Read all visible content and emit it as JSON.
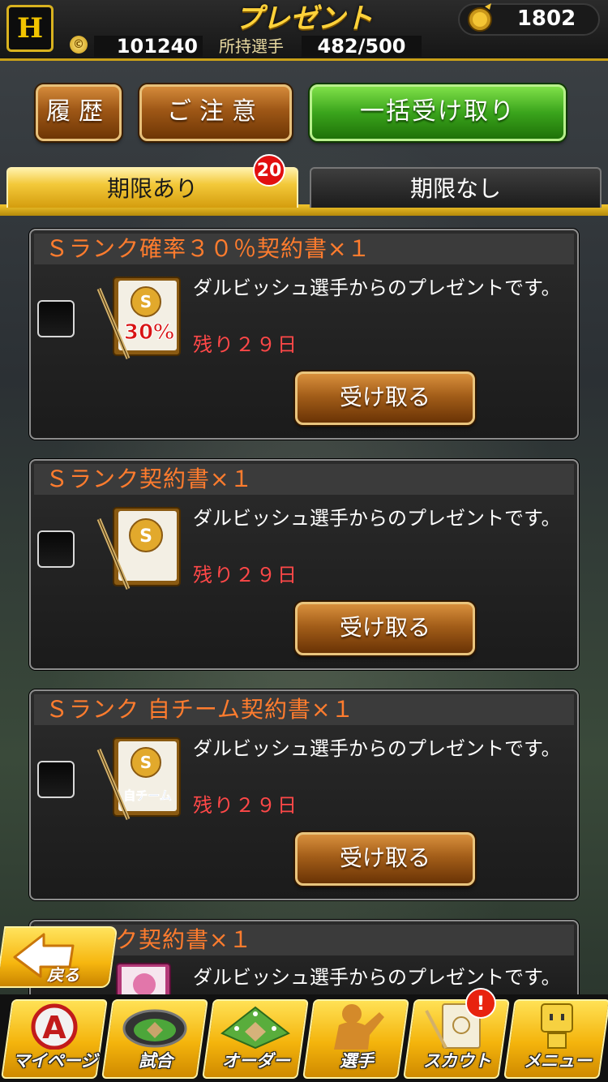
{
  "header": {
    "logo_text": "H",
    "title": "プレゼント",
    "coins": "1802",
    "gold": "101240",
    "players_label": "所持選手",
    "players_count": "482/500"
  },
  "toolbar": {
    "history_label": "履歴",
    "notice_label": "ご注意",
    "receive_all_label": "一括受け取り"
  },
  "tabs": {
    "active_label": "期限あり",
    "inactive_label": "期限なし",
    "badge_count": "20"
  },
  "presents": [
    {
      "title": "Ｓランク確率３０％契約書×１",
      "description": "ダルビッシュ選手からのプレゼントです。",
      "remaining": "残り２９日",
      "button": "受け取る",
      "icon_text": "30%"
    },
    {
      "title": "Ｓランク契約書×１",
      "description": "ダルビッシュ選手からのプレゼントです。",
      "remaining": "残り２９日",
      "button": "受け取る",
      "icon_text": ""
    },
    {
      "title": "Ｓランク 自チーム契約書×１",
      "description": "ダルビッシュ選手からのプレゼントです。",
      "remaining": "残り２９日",
      "button": "受け取る",
      "icon_text": "自チーム"
    },
    {
      "title": "ク契約書×１",
      "description": "ダルビッシュ選手からのプレゼントです。"
    }
  ],
  "back_label": "戻る",
  "nav": [
    {
      "label": "マイページ",
      "icon": "a-emblem-icon"
    },
    {
      "label": "試合",
      "icon": "stadium-icon"
    },
    {
      "label": "オーダー",
      "icon": "field-icon"
    },
    {
      "label": "選手",
      "icon": "player-icon"
    },
    {
      "label": "スカウト",
      "icon": "scout-card-icon"
    },
    {
      "label": "メニュー",
      "icon": "menu-robot-icon"
    }
  ],
  "nav_alert": "!",
  "colors": {
    "accent_gold": "#f3c93a",
    "title_orange": "#ff7c2e",
    "remain_red": "#ff4848",
    "alert_red": "#e8230f"
  }
}
